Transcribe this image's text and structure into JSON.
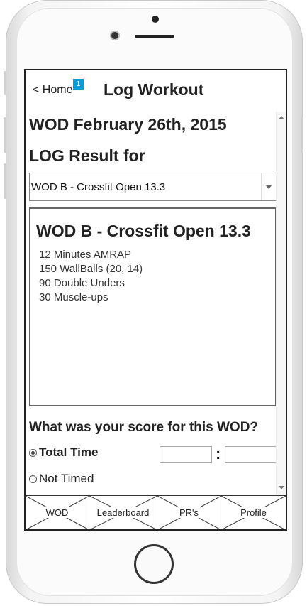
{
  "header": {
    "back_label": "< Home",
    "badge_count": "1",
    "title": "Log Workout"
  },
  "main": {
    "wod_date": "WOD February 26th, 2015",
    "log_label": "LOG Result for",
    "select": {
      "value": "WOD B - Crossfit Open 13.3"
    },
    "card": {
      "title": "WOD B - Crossfit Open 13.3",
      "lines": [
        "12 Minutes AMRAP",
        "150 WallBalls (20, 14)",
        "90 Double Unders",
        "30 Muscle-ups"
      ]
    },
    "score_question": "What was your score for this WOD?",
    "options": [
      {
        "label": "Total Time",
        "selected": true
      },
      {
        "label": "Not Timed",
        "selected": false
      }
    ],
    "time_separator": ":",
    "time_minutes": "",
    "time_seconds": ""
  },
  "tabs": [
    "WOD",
    "Leaderboard",
    "PR's",
    "Profile"
  ],
  "colors": {
    "badge": "#0a9bd8",
    "frame": "#222222"
  }
}
